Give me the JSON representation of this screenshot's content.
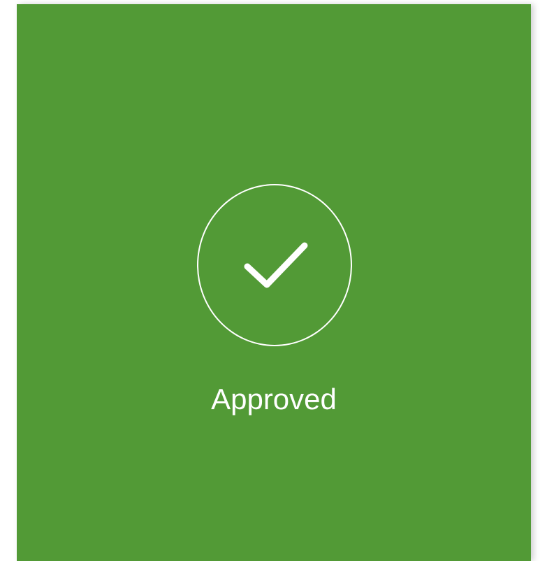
{
  "status": {
    "label": "Approved",
    "icon": "check-icon",
    "background_color": "#529a36",
    "foreground_color": "#ffffff"
  }
}
